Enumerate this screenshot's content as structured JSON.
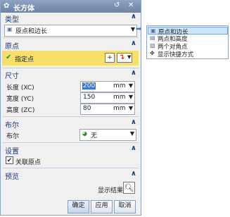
{
  "dialog": {
    "title": "长方体",
    "sections": {
      "type": {
        "label": "类型",
        "combo_value": "原点和边长"
      },
      "origin": {
        "label": "原点",
        "point_label": "指定点"
      },
      "size": {
        "label": "尺寸",
        "rows": [
          {
            "label": "长度 (XC)",
            "value": "200",
            "unit": "mm"
          },
          {
            "label": "宽度 (YC)",
            "value": "150",
            "unit": "mm"
          },
          {
            "label": "高度 (ZC)",
            "value": "80",
            "unit": "mm"
          }
        ]
      },
      "boolean": {
        "label": "布尔",
        "field_label": "布尔",
        "combo_value": "无"
      },
      "settings": {
        "label": "设置",
        "checkbox_label": "关联原点",
        "checkbox_checked": true
      },
      "preview": {
        "label": "预览",
        "show_result_label": "显示结果"
      }
    },
    "buttons": {
      "ok": "确定",
      "apply": "应用",
      "cancel": "取消"
    }
  },
  "dropdown": {
    "items": [
      {
        "label": "原点和边长",
        "selected": true,
        "icon": "cube-origin-icon"
      },
      {
        "label": "两点和高度",
        "selected": false,
        "icon": "cube-two-points-icon"
      },
      {
        "label": "两个对角点",
        "selected": false,
        "icon": "cube-diagonal-icon"
      },
      {
        "label": "显示快捷方式",
        "selected": false,
        "icon": "shortcut-icon"
      }
    ]
  },
  "colors": {
    "titlebar": "#7a92b4",
    "section_header": "#1f3a6d",
    "selected_row": "#f7e06a",
    "dropdown_selected": "#cde3f7"
  }
}
